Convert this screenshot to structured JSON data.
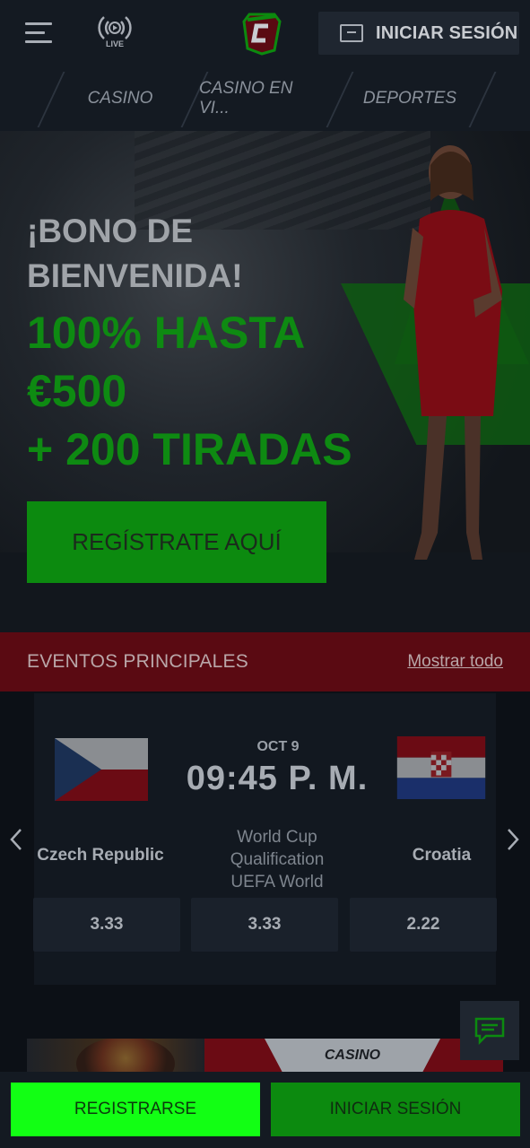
{
  "header": {
    "live_label": "LIVE",
    "login_label": "INICIAR SESIÓN"
  },
  "nav": {
    "items": [
      {
        "label": "CASINO"
      },
      {
        "label": "CASINO EN VI..."
      },
      {
        "label": "DEPORTES"
      }
    ]
  },
  "hero": {
    "line1": "¡BONO DE",
    "line2": "BIENVENIDA!",
    "green1": "100% HASTA",
    "green2": "€500",
    "green3": "+ 200 TIRADAS",
    "cta_label": "REGÍSTRATE AQUÍ"
  },
  "events": {
    "title": "EVENTOS PRINCIPALES",
    "show_all": "Mostrar todo",
    "match": {
      "date": "OCT 9",
      "time": "09:45 P. M.",
      "home": "Czech Republic",
      "away": "Croatia",
      "league_lines": [
        "World Cup",
        "Qualification",
        "UEFA World"
      ],
      "odds": [
        "3.33",
        "3.33",
        "2.22"
      ]
    }
  },
  "promo": {
    "label": "CASINO"
  },
  "bottom": {
    "register_label": "REGISTRARSE",
    "login_label": "INICIAR SESIÓN"
  },
  "colors": {
    "brand_green": "#0c8a0f",
    "bright_green": "#12ff14",
    "events_red": "#5a0a12",
    "header_bg": "#141a22"
  },
  "icons": {
    "menu": "hamburger-icon",
    "live": "live-broadcast-icon",
    "logo": "brand-logo",
    "key": "key-icon",
    "prev": "chevron-left-icon",
    "next": "chevron-right-icon",
    "chat": "chat-icon"
  }
}
